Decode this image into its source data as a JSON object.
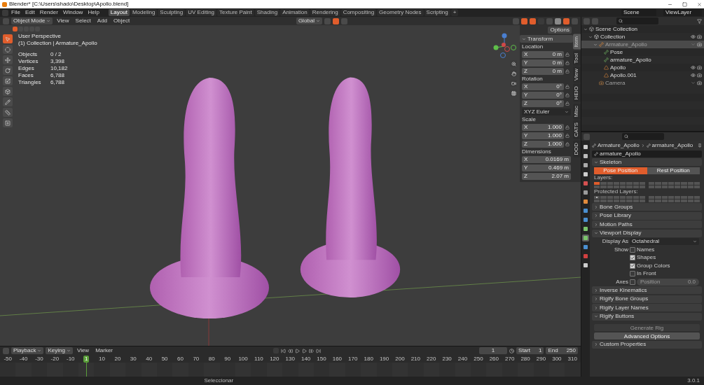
{
  "window": {
    "title": "Blender* [C:\\Users\\shado\\Desktop\\Apollo.blend]"
  },
  "menus": [
    "File",
    "Edit",
    "Render",
    "Window",
    "Help"
  ],
  "workspace_tabs": [
    {
      "label": "Layout",
      "selected": true
    },
    {
      "label": "Modeling",
      "selected": false
    },
    {
      "label": "Sculpting",
      "selected": false
    },
    {
      "label": "UV Editing",
      "selected": false
    },
    {
      "label": "Texture Paint",
      "selected": false
    },
    {
      "label": "Shading",
      "selected": false
    },
    {
      "label": "Animation",
      "selected": false
    },
    {
      "label": "Rendering",
      "selected": false
    },
    {
      "label": "Compositing",
      "selected": false
    },
    {
      "label": "Geometry Nodes",
      "selected": false
    },
    {
      "label": "Scripting",
      "selected": false
    },
    {
      "label": "+",
      "selected": false
    }
  ],
  "scene": "Scene",
  "view_layer": "ViewLayer",
  "viewport": {
    "mode": "Object Mode",
    "menus": [
      "View",
      "Select",
      "Add",
      "Object"
    ],
    "orientation": "Global",
    "options": "Options",
    "select_modes": [
      {
        "selected": true
      },
      {
        "selected": false
      },
      {
        "selected": false
      },
      {
        "selected": false
      },
      {
        "selected": false
      }
    ],
    "tools": [
      {
        "selected": true
      },
      {
        "selected": false
      },
      {
        "selected": false
      },
      {
        "selected": false
      },
      {
        "selected": false
      },
      {
        "selected": false
      },
      {
        "selected": false
      },
      {
        "selected": false
      },
      {
        "selected": false
      }
    ],
    "info": [
      "User Perspective",
      "(1) Collection | Armature_Apollo"
    ],
    "stats": [
      {
        "label": "Objects",
        "value": "0 / 2"
      },
      {
        "label": "Vertices",
        "value": "3,398"
      },
      {
        "label": "Edges",
        "value": "10,182"
      },
      {
        "label": "Faces",
        "value": "6,788"
      },
      {
        "label": "Triangles",
        "value": "6,788"
      }
    ]
  },
  "n_panel": {
    "title": "Transform",
    "groups": [
      {
        "label": "Location",
        "fields": [
          {
            "axis": "X",
            "value": "0 m"
          },
          {
            "axis": "Y",
            "value": "0 m"
          },
          {
            "axis": "Z",
            "value": "0 m"
          }
        ]
      },
      {
        "label": "Rotation",
        "fields": [
          {
            "axis": "X",
            "value": "0°"
          },
          {
            "axis": "Y",
            "value": "0°"
          },
          {
            "axis": "Z",
            "value": "0°"
          }
        ],
        "mode": "XYZ Euler"
      },
      {
        "label": "Scale",
        "fields": [
          {
            "axis": "X",
            "value": "1.000"
          },
          {
            "axis": "Y",
            "value": "1.000"
          },
          {
            "axis": "Z",
            "value": "1.000"
          }
        ]
      },
      {
        "label": "Dimensions",
        "fields": [
          {
            "axis": "X",
            "value": "0.0169 m"
          },
          {
            "axis": "Y",
            "value": "0.469 m"
          },
          {
            "axis": "Z",
            "value": "2.07 m"
          }
        ]
      }
    ],
    "tabs": [
      {
        "label": "Item",
        "selected": true
      },
      {
        "label": "Tool",
        "selected": false
      },
      {
        "label": "View",
        "selected": false
      },
      {
        "label": "HEIO",
        "selected": false
      },
      {
        "label": "Misc",
        "selected": false
      },
      {
        "label": "CATS",
        "selected": false
      },
      {
        "label": "DOD",
        "selected": false
      }
    ]
  },
  "outliner": {
    "items": [
      {
        "label": "Scene Collection",
        "kind": "scene",
        "disabled": false,
        "selected": false,
        "children": [
          {
            "label": "Collection",
            "kind": "collection",
            "disabled": false,
            "selected": false,
            "children": [
              {
                "label": "Armature_Apollo",
                "kind": "armature",
                "disabled": true,
                "selected": true,
                "children": [
                  {
                    "label": "Pose",
                    "kind": "pose",
                    "disabled": false,
                    "selected": false
                  },
                  {
                    "label": "armature_Apollo",
                    "kind": "armature_data",
                    "disabled": false,
                    "selected": false
                  },
                  {
                    "label": "Apollo",
                    "kind": "mesh",
                    "disabled": false,
                    "selected": false
                  },
                  {
                    "label": "Apollo.001",
                    "kind": "mesh",
                    "disabled": false,
                    "selected": false
                  }
                ]
              },
              {
                "label": "Camera",
                "kind": "camera",
                "disabled": true,
                "selected": false
              }
            ]
          }
        ]
      }
    ]
  },
  "properties": {
    "tabs": [
      {
        "selected": false
      },
      {
        "selected": false
      },
      {
        "selected": false
      },
      {
        "selected": false
      },
      {
        "selected": false
      },
      {
        "selected": false
      },
      {
        "selected": false
      },
      {
        "selected": false
      },
      {
        "selected": false
      },
      {
        "selected": false
      },
      {
        "selected": true
      },
      {
        "selected": false
      },
      {
        "selected": false
      },
      {
        "selected": false
      }
    ],
    "breadcrumb": [
      "Armature_Apollo",
      "armature_Apollo"
    ],
    "data_name": "armature_Apollo",
    "panels": [
      {
        "kind": "skeleton",
        "title": "Skeleton",
        "expanded": true,
        "positions": [
          {
            "label": "Pose Position",
            "selected": true
          },
          {
            "label": "Rest Position",
            "selected": false
          }
        ],
        "layers_label": "Layers:",
        "layers": [
          true,
          false,
          false,
          false,
          false,
          false,
          false,
          false,
          false,
          false,
          false,
          false,
          false,
          false,
          false,
          false,
          false,
          false,
          false,
          false,
          false,
          false,
          false,
          false,
          false,
          false,
          false,
          false,
          false,
          false,
          false,
          false
        ],
        "protected_label": "Protected Layers:",
        "protected": [
          true,
          false,
          false,
          false,
          false,
          false,
          false,
          false,
          false,
          false,
          false,
          false,
          false,
          false,
          false,
          false,
          false,
          false,
          false,
          false,
          false,
          false,
          false,
          false,
          false,
          false,
          false,
          false,
          false,
          false,
          false,
          false
        ]
      },
      {
        "kind": "plain",
        "title": "Bone Groups",
        "expanded": false
      },
      {
        "kind": "plain",
        "title": "Pose Library",
        "expanded": false
      },
      {
        "kind": "plain",
        "title": "Motion Paths",
        "expanded": false
      },
      {
        "kind": "display",
        "title": "Viewport Display",
        "expanded": true,
        "display_label": "Display As",
        "display_as": "Octahedral",
        "show_label": "Show",
        "checks": [
          {
            "label": "Names",
            "checked": false
          },
          {
            "label": "Shapes",
            "checked": true
          },
          {
            "label": "Group Colors",
            "checked": true
          },
          {
            "label": "In Front",
            "checked": false
          }
        ],
        "axes_label": "Axes",
        "axes_checked": false,
        "position_label": "Position",
        "position_value": "0.0"
      },
      {
        "kind": "plain",
        "title": "Inverse Kinematics",
        "expanded": false
      },
      {
        "kind": "plain",
        "title": "Rigify Bone Groups",
        "expanded": false
      },
      {
        "kind": "plain",
        "title": "Rigify Layer Names",
        "expanded": false
      },
      {
        "kind": "buttons",
        "title": "Rigify Buttons",
        "expanded": true,
        "buttons": [
          {
            "label": "Generate Rig",
            "disabled": true
          },
          {
            "label": "Advanced Options",
            "disabled": false
          }
        ]
      },
      {
        "kind": "plain",
        "title": "Custom Properties",
        "expanded": false
      }
    ]
  },
  "timeline": {
    "menus": [
      "Playback",
      "Keying",
      "View",
      "Marker"
    ],
    "current_frame": "1",
    "start_label": "Start",
    "start": "1",
    "end_label": "End",
    "end": "250",
    "ruler": [
      {
        "label": "-50"
      },
      {
        "label": "-40"
      },
      {
        "label": "-30"
      },
      {
        "label": "-20"
      },
      {
        "label": "-10"
      },
      {
        "label": "1",
        "kind": "playhead"
      },
      {
        "label": "10"
      },
      {
        "label": "20"
      },
      {
        "label": "30"
      },
      {
        "label": "40"
      },
      {
        "label": "50"
      },
      {
        "label": "60"
      },
      {
        "label": "70"
      },
      {
        "label": "80"
      },
      {
        "label": "90"
      },
      {
        "label": "100"
      },
      {
        "label": "110"
      },
      {
        "label": "120"
      },
      {
        "label": "130"
      },
      {
        "label": "140"
      },
      {
        "label": "150"
      },
      {
        "label": "160"
      },
      {
        "label": "170"
      },
      {
        "label": "180"
      },
      {
        "label": "190"
      },
      {
        "label": "200"
      },
      {
        "label": "210"
      },
      {
        "label": "220"
      },
      {
        "label": "230"
      },
      {
        "label": "240"
      },
      {
        "label": "250"
      },
      {
        "label": "260"
      },
      {
        "label": "270"
      },
      {
        "label": "280"
      },
      {
        "label": "290"
      },
      {
        "label": "300"
      },
      {
        "label": "310"
      }
    ]
  },
  "status_bar": {
    "hint": "Seleccionar",
    "version": "3.0.1"
  }
}
